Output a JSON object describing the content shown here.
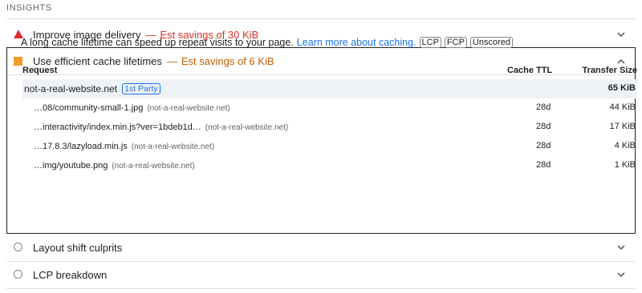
{
  "section_title": "INSIGHTS",
  "insights": {
    "improve_image": {
      "title": "Improve image delivery",
      "separator": "—",
      "savings": "Est savings of 30 KiB",
      "status_color": "#e02b2b"
    },
    "cache": {
      "title": "Use efficient cache lifetimes",
      "separator": "—",
      "savings": "Est savings of 6 KiB",
      "status_color": "#f29b2a",
      "description": "A long cache lifetime can speed up repeat visits to your page.",
      "learn_more": "Learn more about caching.",
      "tags": [
        "LCP",
        "FCP",
        "Unscored"
      ],
      "table": {
        "headers": {
          "request": "Request",
          "cache_ttl": "Cache TTL",
          "transfer_size": "Transfer Size"
        },
        "group": {
          "name": "not-a-real-website.net",
          "badge": "1st Party",
          "size": "65 KiB"
        },
        "rows": [
          {
            "url": "…08/community-small-1.jpg",
            "host": "(not-a-real-website.net)",
            "ttl": "28d",
            "size": "44 KiB"
          },
          {
            "url": "…interactivity/index.min.js?ver=1bdeb1d…",
            "host": "(not-a-real-website.net)",
            "ttl": "28d",
            "size": "17 KiB"
          },
          {
            "url": "…17.8.3/lazyload.min.js",
            "host": "(not-a-real-website.net)",
            "ttl": "28d",
            "size": "4 KiB"
          },
          {
            "url": "…img/youtube.png",
            "host": "(not-a-real-website.net)",
            "ttl": "28d",
            "size": "1 KiB"
          }
        ]
      }
    },
    "layout_shift": {
      "title": "Layout shift culprits"
    },
    "lcp_breakdown": {
      "title": "LCP breakdown"
    }
  }
}
